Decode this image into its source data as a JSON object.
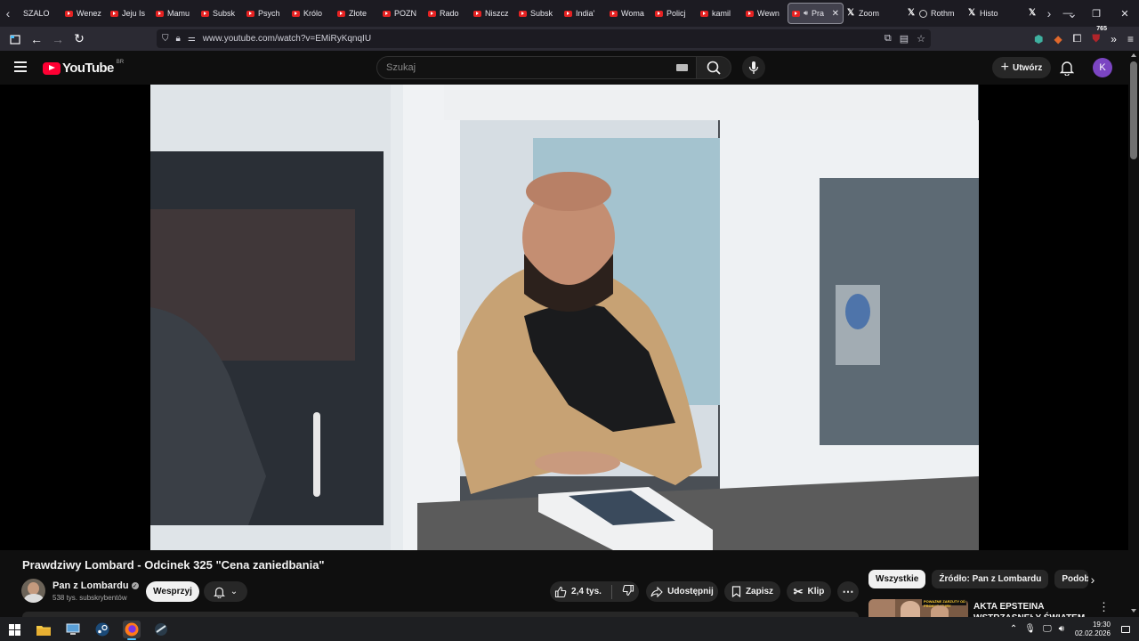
{
  "browser": {
    "tabs": [
      {
        "label": "SZALO",
        "favicon": "blank"
      },
      {
        "label": "Wenez",
        "favicon": "youtube-icon"
      },
      {
        "label": "Jeju Is",
        "favicon": "youtube-icon"
      },
      {
        "label": "Mamu",
        "favicon": "youtube-icon"
      },
      {
        "label": "Subsk",
        "favicon": "youtube-icon"
      },
      {
        "label": "Psych",
        "favicon": "youtube-icon"
      },
      {
        "label": "Królo",
        "favicon": "youtube-icon"
      },
      {
        "label": "Złote",
        "favicon": "youtube-icon"
      },
      {
        "label": "POZN",
        "favicon": "youtube-icon"
      },
      {
        "label": "Rado",
        "favicon": "youtube-icon"
      },
      {
        "label": "Niszcz",
        "favicon": "youtube-icon"
      },
      {
        "label": "Subsk",
        "favicon": "youtube-icon"
      },
      {
        "label": "India'",
        "favicon": "youtube-icon"
      },
      {
        "label": "Woma",
        "favicon": "youtube-icon"
      },
      {
        "label": "Policj",
        "favicon": "youtube-icon"
      },
      {
        "label": "kamil",
        "favicon": "youtube-icon"
      },
      {
        "label": "Wewn",
        "favicon": "youtube-icon"
      }
    ],
    "active_tab": {
      "label": "Pra"
    },
    "after_tabs": [
      {
        "label": "Zoom",
        "favicon": "x-icon"
      },
      {
        "label": "Rothm",
        "favicon": "x-icon"
      },
      {
        "label": "Histo",
        "favicon": "x-icon"
      }
    ],
    "url": "www.youtube.com/watch?v=EMiRyKqnqIU",
    "extension_badge": "765"
  },
  "youtube": {
    "logo_text": "YouTube",
    "country_code": "BR",
    "search_placeholder": "Szukaj",
    "create_label": "Utwórz",
    "avatar_letter": "K",
    "video_title": "Prawdziwy Lombard - Odcinek 325 \"Cena zaniedbania\"",
    "channel_name": "Pan z Lombardu",
    "subscribers": "538 tys. subskrybentów",
    "support_label": "Wesprzyj",
    "like_count": "2,4 tys.",
    "share_label": "Udostępnij",
    "save_label": "Zapisz",
    "clip_label": "Klip",
    "chips": [
      "Wszystkie",
      "Źródło: Pan z Lombardu",
      "Podobne"
    ],
    "recommendation": {
      "title": "AKTA EPSTEINA WSTRZĄSNĘŁY ŚWIATEM",
      "thumb_text": "POWAŻNE ZARZUTY OD PROKURATURY"
    }
  },
  "taskbar": {
    "time": "19:30",
    "date": "02.02.2026"
  },
  "colors": {
    "youtube_red": "#ff0033",
    "avatar_purple": "#7b45c2",
    "background": "#0f0f0f"
  }
}
